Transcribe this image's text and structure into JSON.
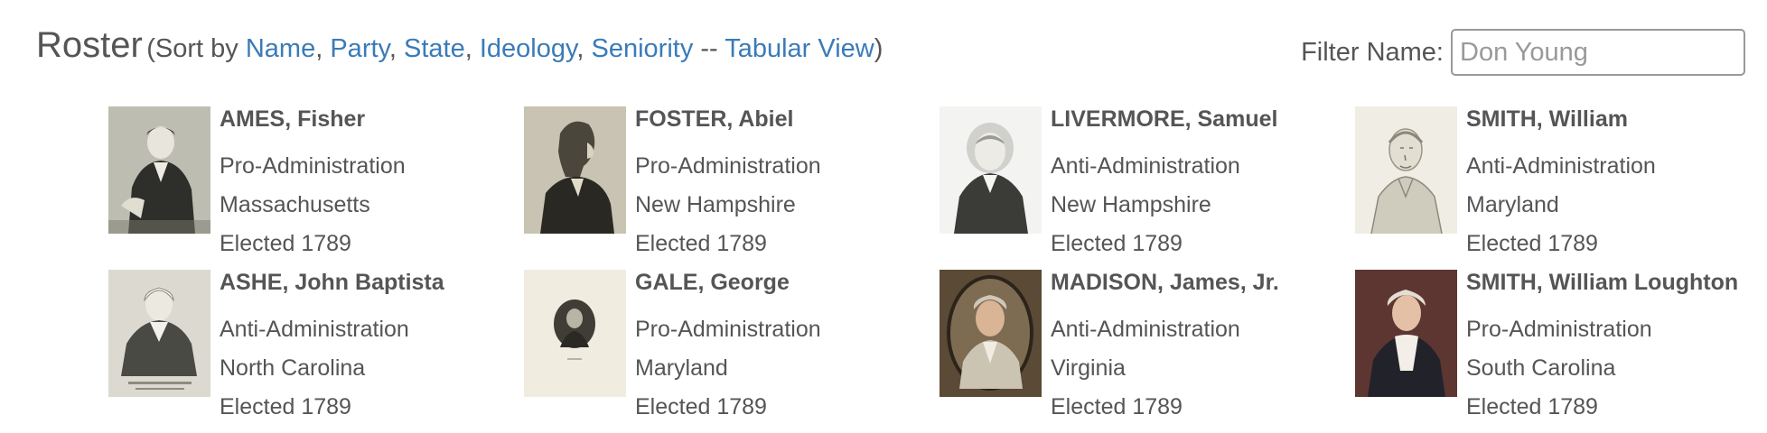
{
  "header": {
    "title": "Roster",
    "sort_prefix": "(Sort by ",
    "sort_links": [
      "Name",
      "Party",
      "State",
      "Ideology",
      "Seniority"
    ],
    "separator": ", ",
    "dash": " -- ",
    "tabular_link": "Tabular View",
    "sort_suffix": ")"
  },
  "filter": {
    "label": "Filter Name:",
    "placeholder": "Don Young",
    "value": ""
  },
  "members": [
    {
      "name": "AMES, Fisher",
      "party": "Pro-Administration",
      "state": "Massachusetts",
      "elected": "Elected 1789",
      "portrait": "engraving-seated-man-portrait"
    },
    {
      "name": "FOSTER, Abiel",
      "party": "Pro-Administration",
      "state": "New Hampshire",
      "elected": "Elected 1789",
      "portrait": "profile-silhouette-engraving-portrait"
    },
    {
      "name": "LIVERMORE, Samuel",
      "party": "Anti-Administration",
      "state": "New Hampshire",
      "elected": "Elected 1789",
      "portrait": "bw-engraving-portrait"
    },
    {
      "name": "SMITH, William",
      "party": "Anti-Administration",
      "state": "Maryland",
      "elected": "Elected 1789",
      "portrait": "pencil-sketch-portrait"
    },
    {
      "name": "ASHE, John Baptista",
      "party": "Anti-Administration",
      "state": "North Carolina",
      "elected": "Elected 1789",
      "portrait": "engraving-uniform-portrait"
    },
    {
      "name": "GALE, George",
      "party": "Pro-Administration",
      "state": "Maryland",
      "elected": "Elected 1789",
      "portrait": "oval-miniature-portrait"
    },
    {
      "name": "MADISON, James, Jr.",
      "party": "Anti-Administration",
      "state": "Virginia",
      "elected": "Elected 1789",
      "portrait": "oval-oil-painting-portrait"
    },
    {
      "name": "SMITH, William Loughton",
      "party": "Pro-Administration",
      "state": "South Carolina",
      "elected": "Elected 1789",
      "portrait": "oil-painting-portrait"
    }
  ]
}
